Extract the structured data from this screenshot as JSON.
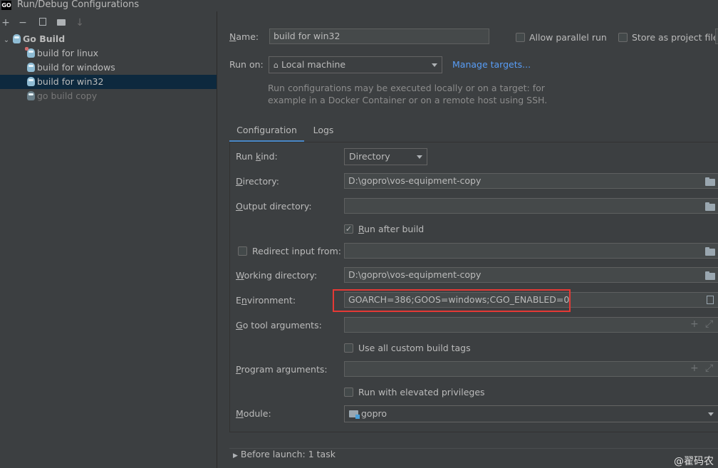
{
  "window": {
    "logo": "GO",
    "title": "Run/Debug Configurations"
  },
  "toolbar": {
    "add": "+",
    "remove": "−",
    "copy": "⧉",
    "folder": "▸",
    "sort": "↓"
  },
  "tree": {
    "group": "Go Build",
    "items": [
      {
        "label": "build for linux"
      },
      {
        "label": "build for windows"
      },
      {
        "label": "build for win32"
      },
      {
        "label": "go build copy"
      }
    ]
  },
  "header": {
    "name_label": "Name:",
    "name_value": "build for win32",
    "allow_parallel": "Allow parallel run",
    "store_project": "Store as project file",
    "run_on_label": "Run on:",
    "run_on_value": "Local machine",
    "manage_targets": "Manage targets...",
    "hint_line1": "Run configurations may be executed locally or on a target: for",
    "hint_line2": "example in a Docker Container or on a remote host using SSH."
  },
  "tabs": [
    {
      "label": "Configuration"
    },
    {
      "label": "Logs"
    }
  ],
  "form": {
    "run_kind_label": "Run kind:",
    "run_kind_value": "Directory",
    "directory_label": "Directory:",
    "directory_value": "D:\\gopro\\vos-equipment-copy",
    "output_dir_label": "Output directory:",
    "output_dir_value": "",
    "run_after_build": "Run after build",
    "redirect_input": "Redirect input from:",
    "working_dir_label": "Working directory:",
    "working_dir_value": "D:\\gopro\\vos-equipment-copy",
    "environment_label": "Environment:",
    "environment_value": "GOARCH=386;GOOS=windows;CGO_ENABLED=0",
    "go_tool_args_label": "Go tool arguments:",
    "use_custom_tags": "Use all custom build tags",
    "program_args_label": "Program arguments:",
    "run_elevated": "Run with elevated privileges",
    "module_label": "Module:",
    "module_value": "gopro"
  },
  "before_launch": "Before launch: 1 task",
  "watermark": "@翟码农",
  "colors": {
    "highlight": "#e53935",
    "link": "#589df6",
    "selection": "#0d293e"
  }
}
